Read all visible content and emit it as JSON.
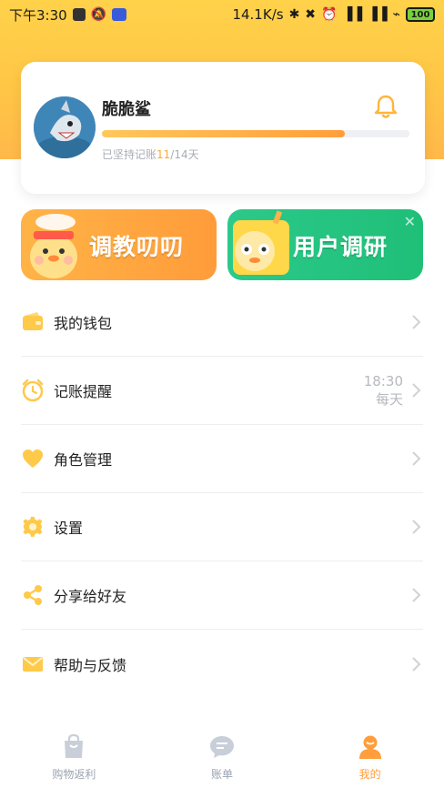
{
  "status_bar": {
    "time": "下午3:30",
    "net_speed": "14.1K/s",
    "battery": "100"
  },
  "profile": {
    "username": "脆脆鲨",
    "progress": 0.79,
    "streak_prefix": "已坚持记账",
    "streak_current": "11",
    "streak_total": "/14天"
  },
  "banners": [
    {
      "label": "调教叨叨",
      "color": "#ffa63e"
    },
    {
      "label": "用户调研",
      "color": "#22c47f"
    }
  ],
  "menu": [
    {
      "label": "我的钱包",
      "icon": "wallet-icon"
    },
    {
      "label": "记账提醒",
      "icon": "alarm-clock-icon",
      "meta_time": "18:30",
      "meta_repeat": "每天"
    },
    {
      "label": "角色管理",
      "icon": "heart-icon"
    },
    {
      "label": "设置",
      "icon": "gear-icon"
    },
    {
      "label": "分享给好友",
      "icon": "share-icon"
    },
    {
      "label": "帮助与反馈",
      "icon": "envelope-icon"
    }
  ],
  "tabs": [
    {
      "label": "购物返利",
      "icon": "shopping-bag-icon"
    },
    {
      "label": "账单",
      "icon": "chat-bubble-icon"
    },
    {
      "label": "我的",
      "icon": "user-icon",
      "active": true
    }
  ],
  "colors": {
    "accent": "#ffa82e",
    "header_bg": "#ffc646",
    "green": "#22c47f",
    "muted": "#a8adb5"
  }
}
